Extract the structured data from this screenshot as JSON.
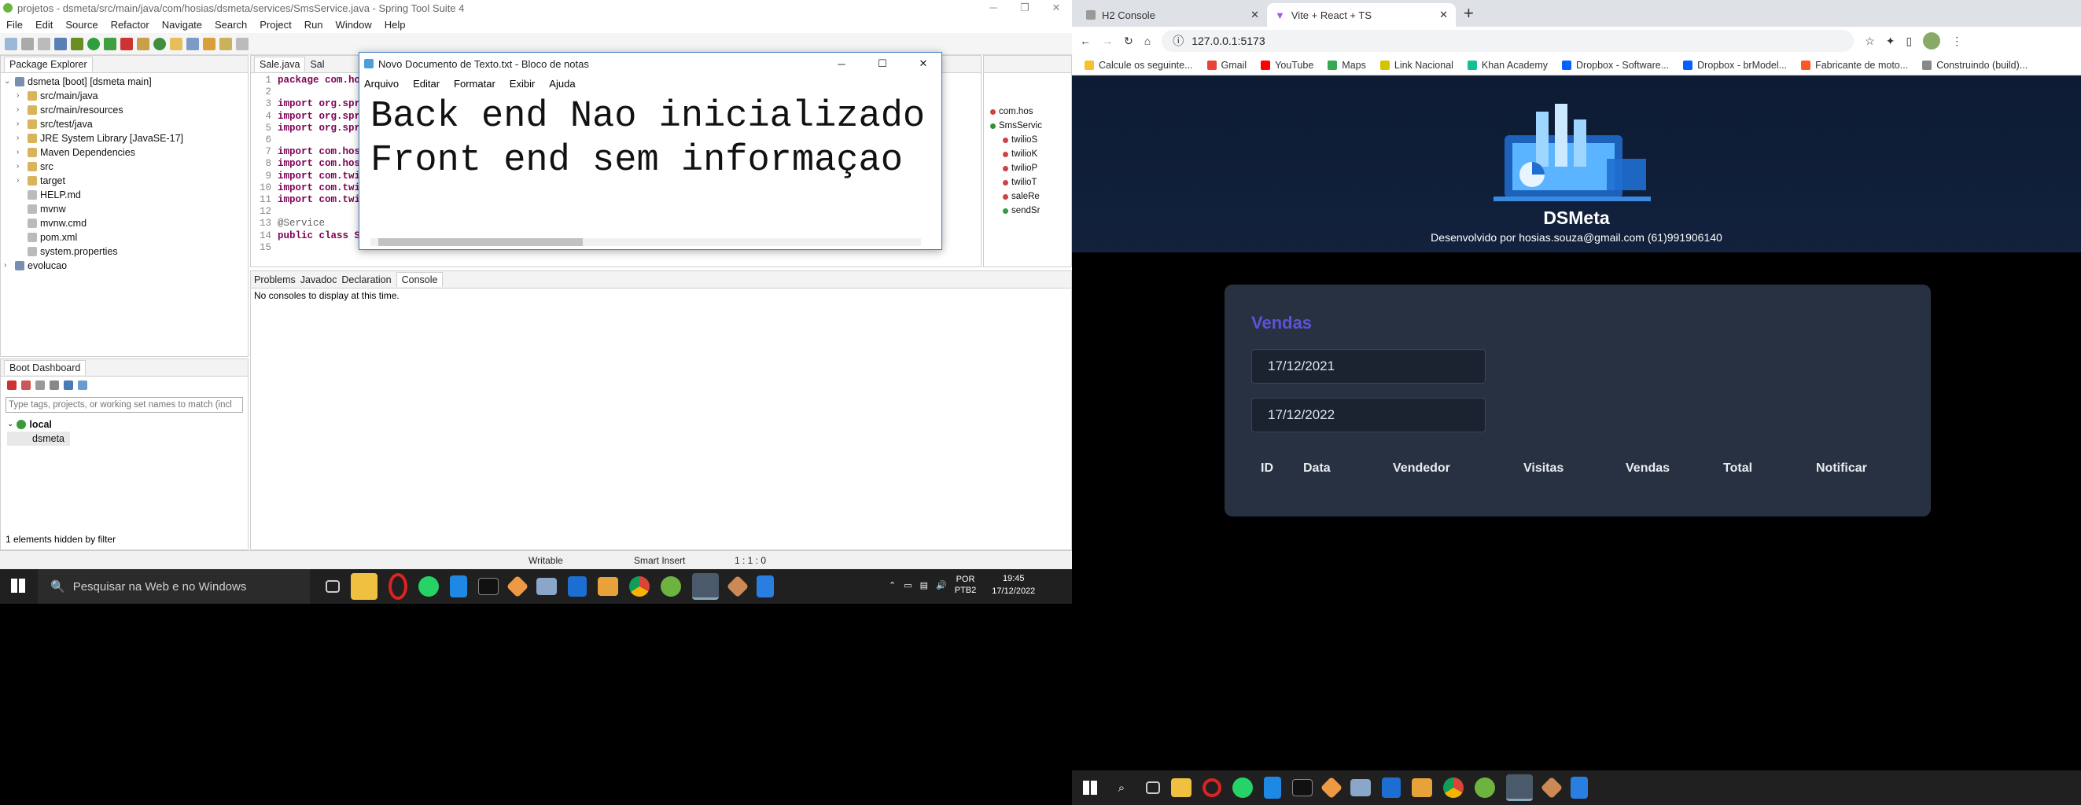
{
  "eclipse": {
    "title": "projetos - dsmeta/src/main/java/com/hosias/dsmeta/services/SmsService.java - Spring Tool Suite 4",
    "menu": [
      "File",
      "Edit",
      "Source",
      "Refactor",
      "Navigate",
      "Search",
      "Project",
      "Run",
      "Window",
      "Help"
    ],
    "package_explorer": {
      "tab": "Package Explorer",
      "items": [
        {
          "label": "dsmeta [boot] [dsmeta main]",
          "indent": 0
        },
        {
          "label": "src/main/java",
          "indent": 1
        },
        {
          "label": "src/main/resources",
          "indent": 1
        },
        {
          "label": "src/test/java",
          "indent": 1
        },
        {
          "label": "JRE System Library [JavaSE-17]",
          "indent": 1
        },
        {
          "label": "Maven Dependencies",
          "indent": 1
        },
        {
          "label": "src",
          "indent": 1
        },
        {
          "label": "target",
          "indent": 1
        },
        {
          "label": "HELP.md",
          "indent": 1
        },
        {
          "label": "mvnw",
          "indent": 1
        },
        {
          "label": "mvnw.cmd",
          "indent": 1
        },
        {
          "label": "pom.xml",
          "indent": 1
        },
        {
          "label": "system.properties",
          "indent": 1
        },
        {
          "label": "evolucao",
          "indent": 0
        }
      ]
    },
    "editor_tabs": [
      "Sale.java",
      "Sal"
    ],
    "code_lines": [
      {
        "n": "1",
        "text": "package com.ho"
      },
      {
        "n": "2",
        "text": ""
      },
      {
        "n": "3",
        "text": "import org.spr"
      },
      {
        "n": "4",
        "text": "import org.spr"
      },
      {
        "n": "5",
        "text": "import org.spr"
      },
      {
        "n": "6",
        "text": ""
      },
      {
        "n": "7",
        "text": "import com.hos"
      },
      {
        "n": "8",
        "text": "import com.hos"
      },
      {
        "n": "9",
        "text": "import com.twi"
      },
      {
        "n": "10",
        "text": "import com.twi"
      },
      {
        "n": "11",
        "text": "import com.twi"
      },
      {
        "n": "12",
        "text": ""
      },
      {
        "n": "13",
        "text": "@Service"
      },
      {
        "n": "14",
        "text": "public class S"
      },
      {
        "n": "15",
        "text": ""
      }
    ],
    "outline_items": [
      "com.hos",
      "SmsServic",
      "twilioS",
      "twilioK",
      "twilioP",
      "twilioT",
      "saleRe",
      "sendSr"
    ],
    "bottom_tabs": [
      "Problems",
      "Javadoc",
      "Declaration",
      "Console"
    ],
    "console_msg": "No consoles to display at this time.",
    "boot_dashboard": {
      "tab": "Boot Dashboard",
      "filter_placeholder": "Type tags, projects, or working set names to match (incl",
      "local": "local",
      "app": "dsmeta",
      "footer": "1 elements hidden by filter"
    },
    "status": {
      "writable": "Writable",
      "insert": "Smart Insert",
      "pos": "1 : 1 : 0"
    }
  },
  "notepad": {
    "title": "Novo Documento de Texto.txt - Bloco de notas",
    "menu": [
      "Arquivo",
      "Editar",
      "Formatar",
      "Exibir",
      "Ajuda"
    ],
    "line1": "Back end Nao inicializado",
    "line2": "Front end sem informaçao"
  },
  "taskbar_left": {
    "search": "Pesquisar na Web e no Windows",
    "lang1": "POR",
    "lang2": "PTB2",
    "time": "19:45",
    "date": "17/12/2022"
  },
  "chrome": {
    "tabs": [
      "H2 Console",
      "Vite + React + TS"
    ],
    "url": "127.0.0.1:5173",
    "bookmarks": [
      "Calcule os seguinte...",
      "Gmail",
      "YouTube",
      "Maps",
      "Link Nacional",
      "Khan Academy",
      "Dropbox - Software...",
      "Dropbox - brModel...",
      "Fabricante de moto...",
      "Construindo (build)..."
    ]
  },
  "app": {
    "brand": "DSMeta",
    "subtitle": "Desenvolvido por hosias.souza@gmail.com (61)991906140",
    "card_title": "Vendas",
    "date_min": "17/12/2021",
    "date_max": "17/12/2022",
    "columns": [
      "ID",
      "Data",
      "Vendedor",
      "Visitas",
      "Vendas",
      "Total",
      "Notificar"
    ]
  },
  "colors": {
    "accent": "#4d41c0",
    "card": "#283142",
    "input": "#1b2331",
    "hero": "#0d1b33"
  }
}
